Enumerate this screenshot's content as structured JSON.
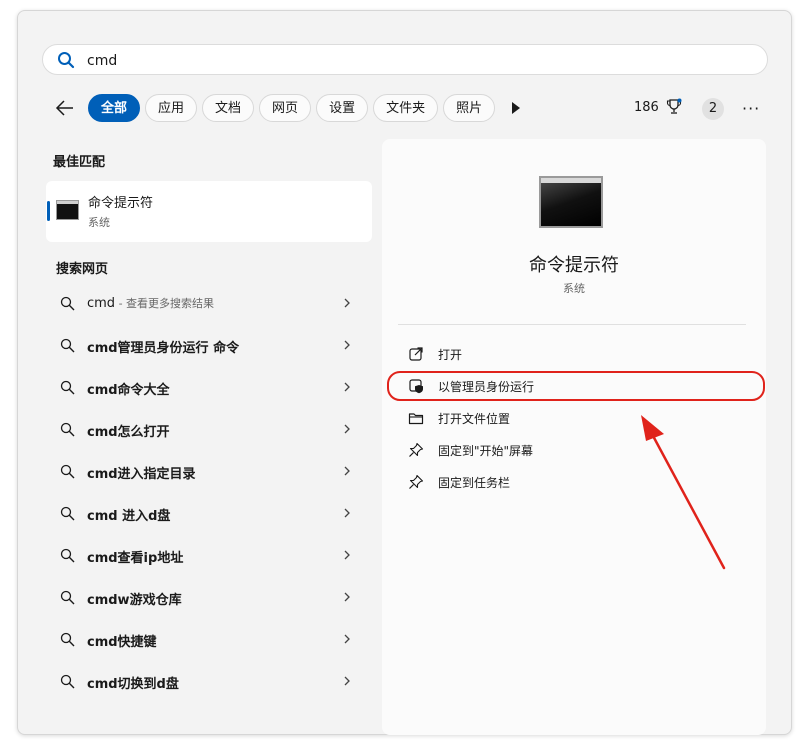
{
  "search": {
    "value": "cmd"
  },
  "filters": [
    "全部",
    "应用",
    "文档",
    "网页",
    "设置",
    "文件夹",
    "照片"
  ],
  "header": {
    "points": "186",
    "badge_count": "2",
    "more": "···"
  },
  "best_match": {
    "section_title": "最佳匹配",
    "name": "命令提示符",
    "type": "系统"
  },
  "web": {
    "section_title": "搜索网页",
    "items": [
      {
        "text": "cmd",
        "hint": " - 查看更多搜索结果"
      },
      {
        "text": "cmd管理员身份运行 命令"
      },
      {
        "text": "cmd命令大全"
      },
      {
        "text": "cmd怎么打开"
      },
      {
        "text": "cmd进入指定目录"
      },
      {
        "text": "cmd 进入d盘"
      },
      {
        "text": "cmd查看ip地址"
      },
      {
        "text": "cmdw游戏仓库"
      },
      {
        "text": "cmd快捷键"
      },
      {
        "text": "cmd切换到d盘"
      }
    ]
  },
  "detail": {
    "name": "命令提示符",
    "type": "系统",
    "actions": [
      "打开",
      "以管理员身份运行",
      "打开文件位置",
      "固定到\"开始\"屏幕",
      "固定到任务栏"
    ]
  },
  "colors": {
    "accent": "#005fb8",
    "annotation": "#e0231b"
  }
}
